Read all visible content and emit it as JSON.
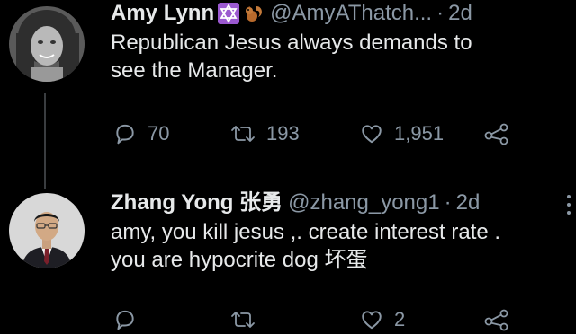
{
  "colors": {
    "background": "#000000",
    "text_primary": "#e7e9ea",
    "text_secondary": "#8b98a5",
    "thread_line": "#3a3d40"
  },
  "tweets": [
    {
      "display_name": "Amy Lynn",
      "badges": [
        "star-of-david-emoji",
        "squirrel-emoji"
      ],
      "handle": "@AmyAThatch...",
      "separator": "·",
      "time": "2d",
      "text_lines": [
        "Republican Jesus always demands to",
        "see the Manager."
      ],
      "actions": {
        "reply_icon": "reply-icon",
        "reply_count": "70",
        "retweet_icon": "retweet-icon",
        "retweet_count": "193",
        "like_icon": "heart-icon",
        "like_count": "1,951",
        "share_icon": "share-icon"
      }
    },
    {
      "display_name": "Zhang Yong 张勇",
      "handle": "@zhang_yong1",
      "separator": "·",
      "time": "2d",
      "text_lines": [
        "amy, you kill jesus ,. create interest rate .",
        "you are hypocrite dog 坏蛋"
      ],
      "actions": {
        "reply_icon": "reply-icon",
        "reply_count": "",
        "retweet_icon": "retweet-icon",
        "retweet_count": "",
        "like_icon": "heart-icon",
        "like_count": "2",
        "share_icon": "share-icon"
      },
      "more_icon": "more-options-icon"
    }
  ]
}
